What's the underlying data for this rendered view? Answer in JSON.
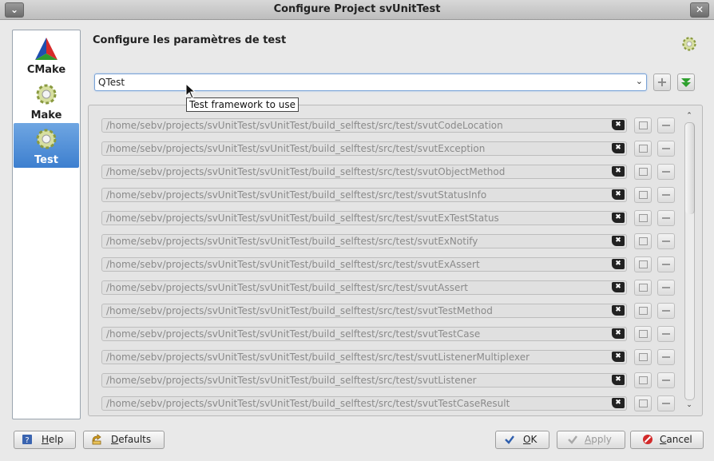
{
  "window": {
    "title": "Configure Project svUnitTest",
    "menu_glyph": "⌄",
    "close_glyph": "✕"
  },
  "nav": {
    "items": [
      {
        "label": "CMake",
        "icon": "cmake-triangle-icon",
        "selected": false
      },
      {
        "label": "Make",
        "icon": "gear-icon",
        "selected": false
      },
      {
        "label": "Test",
        "icon": "gear-icon",
        "selected": true
      }
    ]
  },
  "page": {
    "heading": "Configure les paramètres de test",
    "header_icon": "gear-icon"
  },
  "framework": {
    "value": "QTest",
    "tooltip": "Test framework to use",
    "add_glyph": "+",
    "dropdown_glyph": "⌄"
  },
  "paths": [
    "/home/sebv/projects/svUnitTest/svUnitTest/build_selftest/src/test/svutCodeLocation",
    "/home/sebv/projects/svUnitTest/svUnitTest/build_selftest/src/test/svutException",
    "/home/sebv/projects/svUnitTest/svUnitTest/build_selftest/src/test/svutObjectMethod",
    "/home/sebv/projects/svUnitTest/svUnitTest/build_selftest/src/test/svutStatusInfo",
    "/home/sebv/projects/svUnitTest/svUnitTest/build_selftest/src/test/svutExTestStatus",
    "/home/sebv/projects/svUnitTest/svUnitTest/build_selftest/src/test/svutExNotify",
    "/home/sebv/projects/svUnitTest/svUnitTest/build_selftest/src/test/svutExAssert",
    "/home/sebv/projects/svUnitTest/svUnitTest/build_selftest/src/test/svutAssert",
    "/home/sebv/projects/svUnitTest/svUnitTest/build_selftest/src/test/svutTestMethod",
    "/home/sebv/projects/svUnitTest/svUnitTest/build_selftest/src/test/svutTestCase",
    "/home/sebv/projects/svUnitTest/svUnitTest/build_selftest/src/test/svutListenerMultiplexer",
    "/home/sebv/projects/svUnitTest/svUnitTest/build_selftest/src/test/svutListener",
    "/home/sebv/projects/svUnitTest/svUnitTest/build_selftest/src/test/svutTestCaseResult"
  ],
  "clear_glyph": "✖",
  "scroll": {
    "up_glyph": "⌃",
    "down_glyph": "⌄"
  },
  "buttons": {
    "help": {
      "pre": "",
      "mnemonic": "H",
      "post": "elp"
    },
    "defaults": {
      "pre": "",
      "mnemonic": "D",
      "post": "efaults"
    },
    "ok": {
      "pre": "",
      "mnemonic": "O",
      "post": "K"
    },
    "apply": {
      "pre": "",
      "mnemonic": "A",
      "post": "pply"
    },
    "cancel": {
      "pre": "",
      "mnemonic": "C",
      "post": "ancel"
    }
  },
  "colors": {
    "selection": "#3d7fcf",
    "ok_check": "#2f5fae",
    "cancel_red": "#d22a2a",
    "down_green": "#2ea02e"
  }
}
